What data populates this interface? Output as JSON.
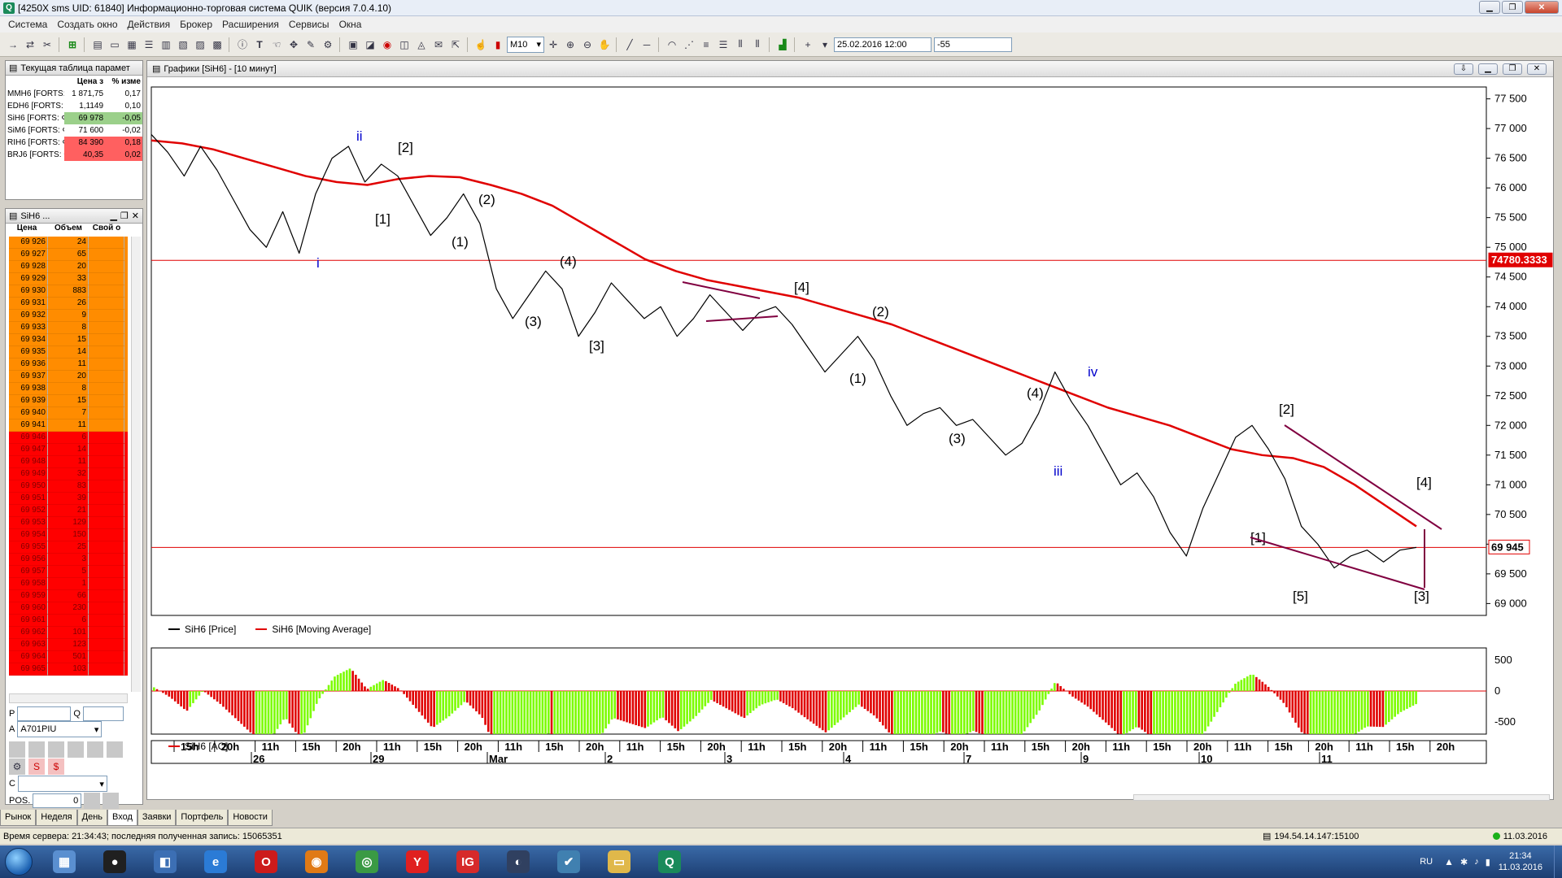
{
  "window": {
    "title": "[4250X sms UID: 61840] Информационно-торговая система QUIK (версия 7.0.4.10)",
    "app_icon": "Q"
  },
  "menu": [
    "Система",
    "Создать окно",
    "Действия",
    "Брокер",
    "Расширения",
    "Сервисы",
    "Окна"
  ],
  "toolbar": {
    "interval": "M10",
    "date_field": "25.02.2016 12:00",
    "offset_field": "-55"
  },
  "params_panel": {
    "title": "Текущая таблица парамет",
    "headers": [
      "",
      "Цена з",
      "% изме"
    ],
    "rows": [
      {
        "name": "MMH6 [FORTS: ",
        "price": "1 871,75",
        "change": "0,17",
        "color": "#ffffff"
      },
      {
        "name": "EDH6 [FORTS: ",
        "price": "1,1149",
        "change": "0,10",
        "color": "#ffffff"
      },
      {
        "name": "SiH6 [FORTS: Ф",
        "price": "69 978",
        "change": "-0,05",
        "color": "#9bd08a"
      },
      {
        "name": "SiM6 [FORTS: Ф",
        "price": "71 600",
        "change": "-0,02",
        "color": "#ffffff"
      },
      {
        "name": "RIH6 [FORTS: Ф",
        "price": "84 390",
        "change": "0,18",
        "color": "#ff6060"
      },
      {
        "name": "BRJ6 [FORTS: Ф",
        "price": "40,35",
        "change": "0,02",
        "color": "#ff6060"
      }
    ]
  },
  "orderbook": {
    "title": "SiH6 ...",
    "headers": [
      "Цена",
      "Объем",
      "Свой о"
    ],
    "asks": [
      [
        "69 926",
        "24"
      ],
      [
        "69 927",
        "65"
      ],
      [
        "69 928",
        "20"
      ],
      [
        "69 929",
        "33"
      ],
      [
        "69 930",
        "883"
      ],
      [
        "69 931",
        "26"
      ],
      [
        "69 932",
        "9"
      ],
      [
        "69 933",
        "8"
      ],
      [
        "69 934",
        "15"
      ],
      [
        "69 935",
        "14"
      ],
      [
        "69 936",
        "11"
      ],
      [
        "69 937",
        "20"
      ],
      [
        "69 938",
        "8"
      ],
      [
        "69 939",
        "15"
      ],
      [
        "69 940",
        "7"
      ],
      [
        "69 941",
        "11"
      ]
    ],
    "bids": [
      [
        "69 946",
        "6"
      ],
      [
        "69 947",
        "14"
      ],
      [
        "69 948",
        "11"
      ],
      [
        "69 949",
        "32"
      ],
      [
        "69 950",
        "83"
      ],
      [
        "69 951",
        "39"
      ],
      [
        "69 952",
        "21"
      ],
      [
        "69 953",
        "129"
      ],
      [
        "69 954",
        "150"
      ],
      [
        "69 955",
        "25"
      ],
      [
        "69 956",
        "3"
      ],
      [
        "69 957",
        "5"
      ],
      [
        "69 958",
        "1"
      ],
      [
        "69 959",
        "66"
      ],
      [
        "69 960",
        "230"
      ],
      [
        "69 961",
        "6"
      ],
      [
        "69 962",
        "101"
      ],
      [
        "69 963",
        "123"
      ],
      [
        "69 964",
        "501"
      ],
      [
        "69 965",
        "103"
      ]
    ],
    "p_label": "P",
    "q_label": "Q",
    "account": "A701PIU",
    "c_label": "C",
    "pos_label": "POS.",
    "pos_value": "0"
  },
  "chart_window": {
    "title": "Графики [SiH6] - [10 минут]",
    "legend_price": "SiH6 [Price]",
    "legend_ma": "SiH6 [Moving Average]",
    "legend_ao": "SiH6 [AO]",
    "price_axis": [
      "77 500",
      "77 000",
      "76 500",
      "76 000",
      "75 500",
      "75 000",
      "74 500",
      "74 000",
      "73 500",
      "73 000",
      "72 500",
      "72 000",
      "71 500",
      "71 000",
      "70 500",
      "70 000",
      "69 500",
      "69 000"
    ],
    "hline_upper_label": "74780.3333",
    "hline_lower_label": "69 945",
    "ao_axis": [
      "500",
      "0",
      "-500"
    ],
    "time_row": [
      "15h",
      "20h",
      "11h",
      "15h",
      "20h",
      "11h",
      "15h",
      "20h",
      "11h",
      "15h",
      "20h",
      "11h",
      "15h",
      "20h",
      "11h",
      "15h",
      "20h",
      "11h",
      "15h",
      "20h",
      "11h",
      "15h",
      "20h",
      "11h",
      "15h",
      "20h",
      "11h",
      "15h",
      "20h",
      "11h",
      "15h",
      "20h"
    ],
    "date_row": [
      "26",
      "29",
      "Mar",
      "2",
      "3",
      "4",
      "7",
      "9",
      "10",
      "11"
    ],
    "wave_labels": [
      {
        "t": "ii",
        "c": "#0000cc"
      },
      {
        "t": "[2]",
        "c": "#000"
      },
      {
        "t": "[1]",
        "c": "#000"
      },
      {
        "t": "i",
        "c": "#0000cc"
      },
      {
        "t": "(2)",
        "c": "#000"
      },
      {
        "t": "(1)",
        "c": "#000"
      },
      {
        "t": "(4)",
        "c": "#000"
      },
      {
        "t": "(3)",
        "c": "#000"
      },
      {
        "t": "[3]",
        "c": "#000"
      },
      {
        "t": "[4]",
        "c": "#000"
      },
      {
        "t": "(2)",
        "c": "#000"
      },
      {
        "t": "(1)",
        "c": "#000"
      },
      {
        "t": "iv",
        "c": "#0000cc"
      },
      {
        "t": "(4)",
        "c": "#000"
      },
      {
        "t": "(3)",
        "c": "#000"
      },
      {
        "t": "iii",
        "c": "#0000cc"
      },
      {
        "t": "[2]",
        "c": "#000"
      },
      {
        "t": "[4]",
        "c": "#000"
      },
      {
        "t": "[1]",
        "c": "#000"
      },
      {
        "t": "[5]",
        "c": "#000"
      },
      {
        "t": "[3]",
        "c": "#000"
      }
    ]
  },
  "chart_data": {
    "type": "line",
    "series": [
      {
        "name": "SiH6 [Price]",
        "values": [
          76900,
          76600,
          76200,
          76700,
          76300,
          75800,
          75300,
          75000,
          75600,
          74900,
          75900,
          76500,
          76700,
          76100,
          76400,
          76200,
          75700,
          75200,
          75500,
          75900,
          75400,
          74300,
          73800,
          74200,
          74600,
          74300,
          73500,
          73900,
          74400,
          74100,
          73800,
          74000,
          73500,
          73800,
          74200,
          73900,
          73600,
          73900,
          74000,
          73700,
          73300,
          72900,
          73200,
          73500,
          73100,
          72500,
          72000,
          72200,
          72300,
          72000,
          72100,
          71800,
          71500,
          71700,
          72200,
          72900,
          72400,
          72000,
          71500,
          71000,
          71200,
          70800,
          70200,
          69800,
          70600,
          71200,
          71800,
          72000,
          71600,
          71100,
          70300,
          70000,
          69600,
          69800,
          69900,
          69700,
          69900,
          69945
        ]
      },
      {
        "name": "SiH6 [Moving Average]",
        "values": [
          76800,
          76750,
          76650,
          76500,
          76350,
          76200,
          76100,
          76050,
          76150,
          76200,
          76180,
          76050,
          75900,
          75700,
          75400,
          75100,
          74800,
          74600,
          74450,
          74350,
          74250,
          74150,
          74000,
          73850,
          73700,
          73500,
          73300,
          73100,
          72900,
          72700,
          72500,
          72300,
          72150,
          72000,
          71800,
          71600,
          71500,
          71450,
          71300,
          71000,
          70650,
          70300
        ]
      }
    ],
    "ylim": [
      68800,
      77700
    ],
    "hlines": [
      74780.3333,
      69945
    ],
    "ao": {
      "name": "SiH6 [AO]",
      "ylim": [
        -700,
        700
      ]
    }
  },
  "tabs": [
    "Рынок",
    "Неделя",
    "День",
    "Вход",
    "Заявки",
    "Портфель",
    "Новости"
  ],
  "status": {
    "server_time": "Время сервера: 21:34:43; последняя полученная запись: 15065351",
    "ip": "194.54.14.147:15100",
    "date": "11.03.2016"
  },
  "taskbar": {
    "lang": "RU",
    "time": "21:34",
    "date": "11.03.2016",
    "apps": [
      {
        "name": "explorer-icon",
        "glyph": "▦",
        "bg": "#5a8fd0"
      },
      {
        "name": "record-icon",
        "glyph": "●",
        "bg": "#202020"
      },
      {
        "name": "tile-icon",
        "glyph": "◧",
        "bg": "#3c6fb4"
      },
      {
        "name": "ie-icon",
        "glyph": "e",
        "bg": "#2b7bd6"
      },
      {
        "name": "opera-icon",
        "glyph": "O",
        "bg": "#cc1b1b"
      },
      {
        "name": "firefox-icon",
        "glyph": "◉",
        "bg": "#e07a16"
      },
      {
        "name": "chrome-icon",
        "glyph": "◎",
        "bg": "#3a9a44"
      },
      {
        "name": "yandex-icon",
        "glyph": "Y",
        "bg": "#e02020"
      },
      {
        "name": "ig-icon",
        "glyph": "IG",
        "bg": "#d62a2a"
      },
      {
        "name": "media-icon",
        "glyph": "◐",
        "bg": "#304060"
      },
      {
        "name": "check-icon",
        "glyph": "✔",
        "bg": "#4080b0"
      },
      {
        "name": "folder-icon",
        "glyph": "▭",
        "bg": "#e0b84a"
      },
      {
        "name": "quik-icon",
        "glyph": "Q",
        "bg": "#1a8a5a"
      }
    ]
  }
}
